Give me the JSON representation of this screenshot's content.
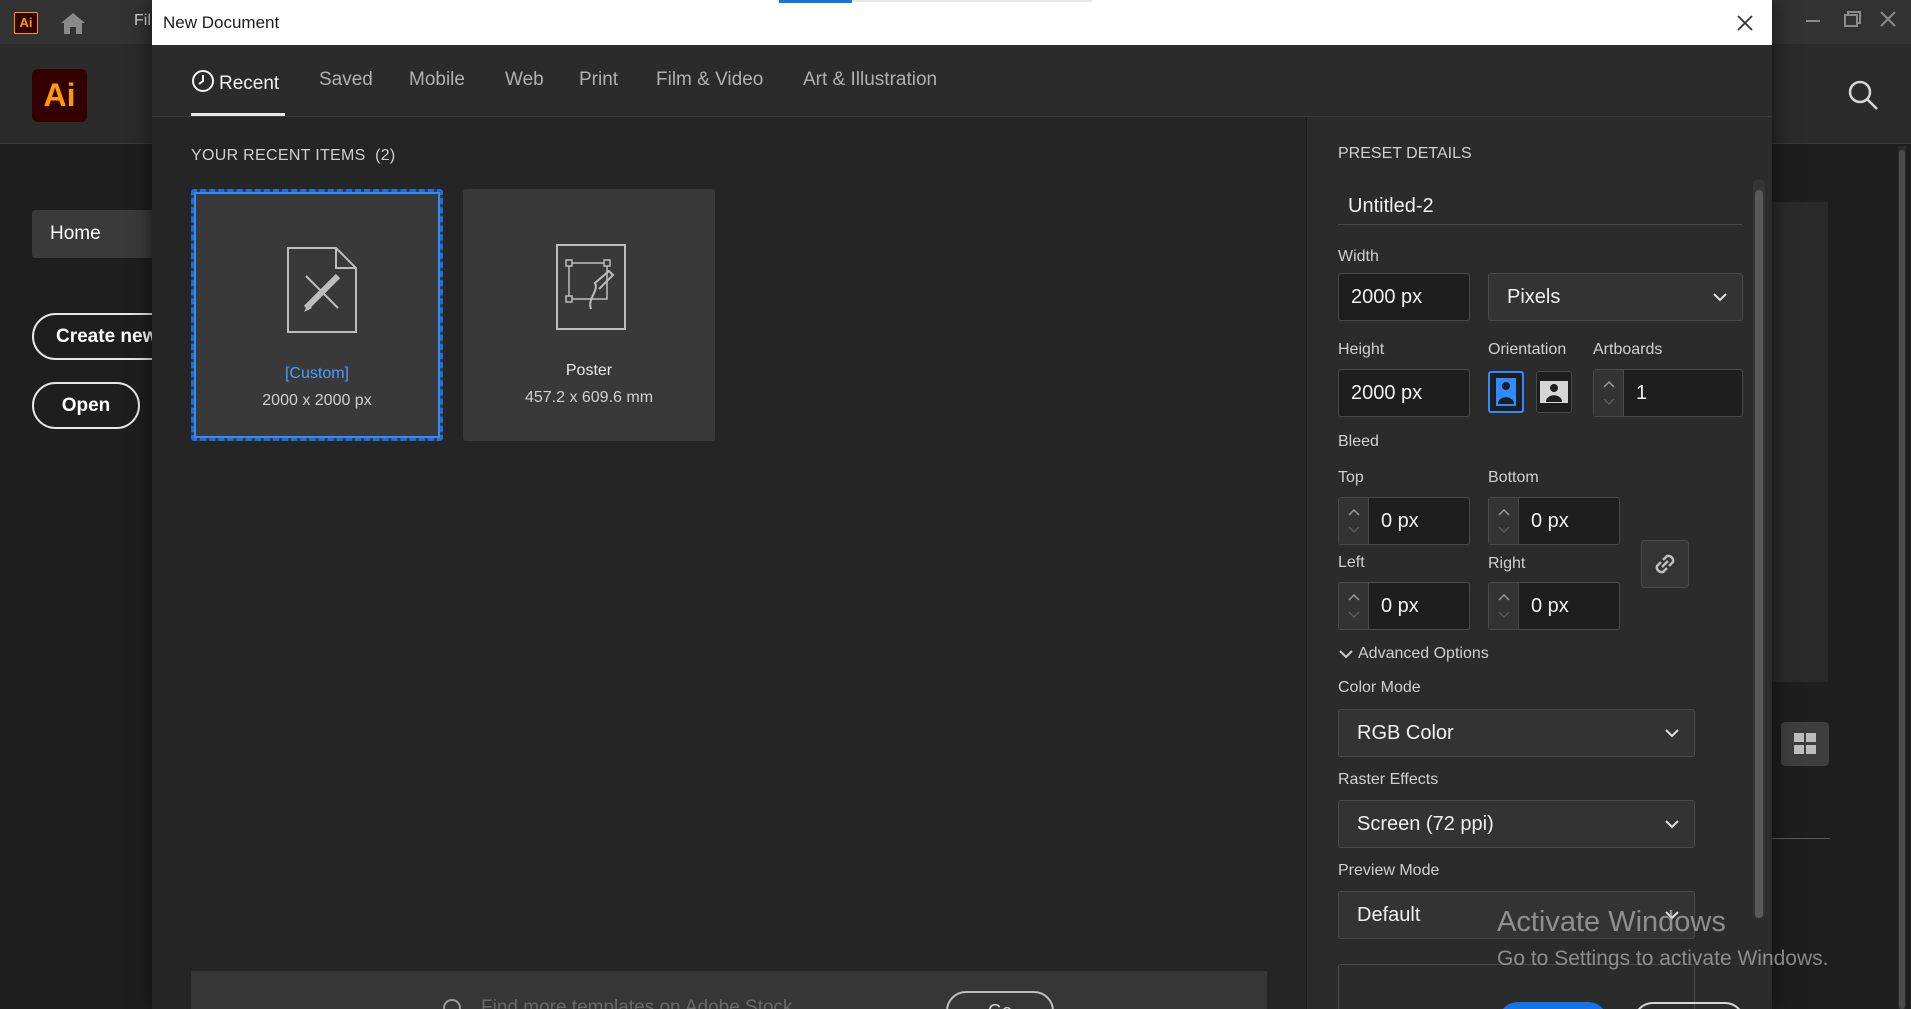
{
  "app": {
    "logo_small": "Ai",
    "logo": "Ai",
    "file_menu": "Fil",
    "home_nav": "Home",
    "create_new": "Create new",
    "open": "Open"
  },
  "dialog": {
    "title": "New Document",
    "tabs": [
      {
        "label": "Recent",
        "active": true
      },
      {
        "label": "Saved"
      },
      {
        "label": "Mobile"
      },
      {
        "label": "Web"
      },
      {
        "label": "Print"
      },
      {
        "label": "Film & Video"
      },
      {
        "label": "Art & Illustration"
      }
    ],
    "recent": {
      "heading": "YOUR RECENT ITEMS",
      "count": "(2)",
      "items": [
        {
          "name": "[Custom]",
          "size": "2000 x 2000 px",
          "selected": true,
          "name_color": "#4a9eff"
        },
        {
          "name": "Poster",
          "size": "457.2 x 609.6 mm",
          "selected": false
        }
      ]
    },
    "stock": {
      "placeholder": "Find more templates on Adobe Stock",
      "button": "Go"
    },
    "preset": {
      "heading": "PRESET DETAILS",
      "name": "Untitled-2",
      "width_label": "Width",
      "width": "2000 px",
      "units": "Pixels",
      "height_label": "Height",
      "height": "2000 px",
      "orientation_label": "Orientation",
      "orientation_selected": "portrait",
      "artboards_label": "Artboards",
      "artboards": "1",
      "bleed_label": "Bleed",
      "bleed": {
        "top_label": "Top",
        "top": "0 px",
        "bottom_label": "Bottom",
        "bottom": "0 px",
        "left_label": "Left",
        "left": "0 px",
        "right_label": "Right",
        "right": "0 px"
      },
      "advanced_label": "Advanced Options",
      "color_mode_label": "Color Mode",
      "color_mode": "RGB Color",
      "raster_label": "Raster Effects",
      "raster": "Screen (72 ppi)",
      "preview_label": "Preview Mode",
      "preview": "Default"
    }
  },
  "watermark": {
    "title": "Activate Windows",
    "subtitle": "Go to Settings to activate Windows."
  },
  "colors": {
    "accent": "#1473e6",
    "selection": "#2f8cff",
    "dialog_bg": "#252525",
    "panel_bg": "#2b2b2b"
  }
}
